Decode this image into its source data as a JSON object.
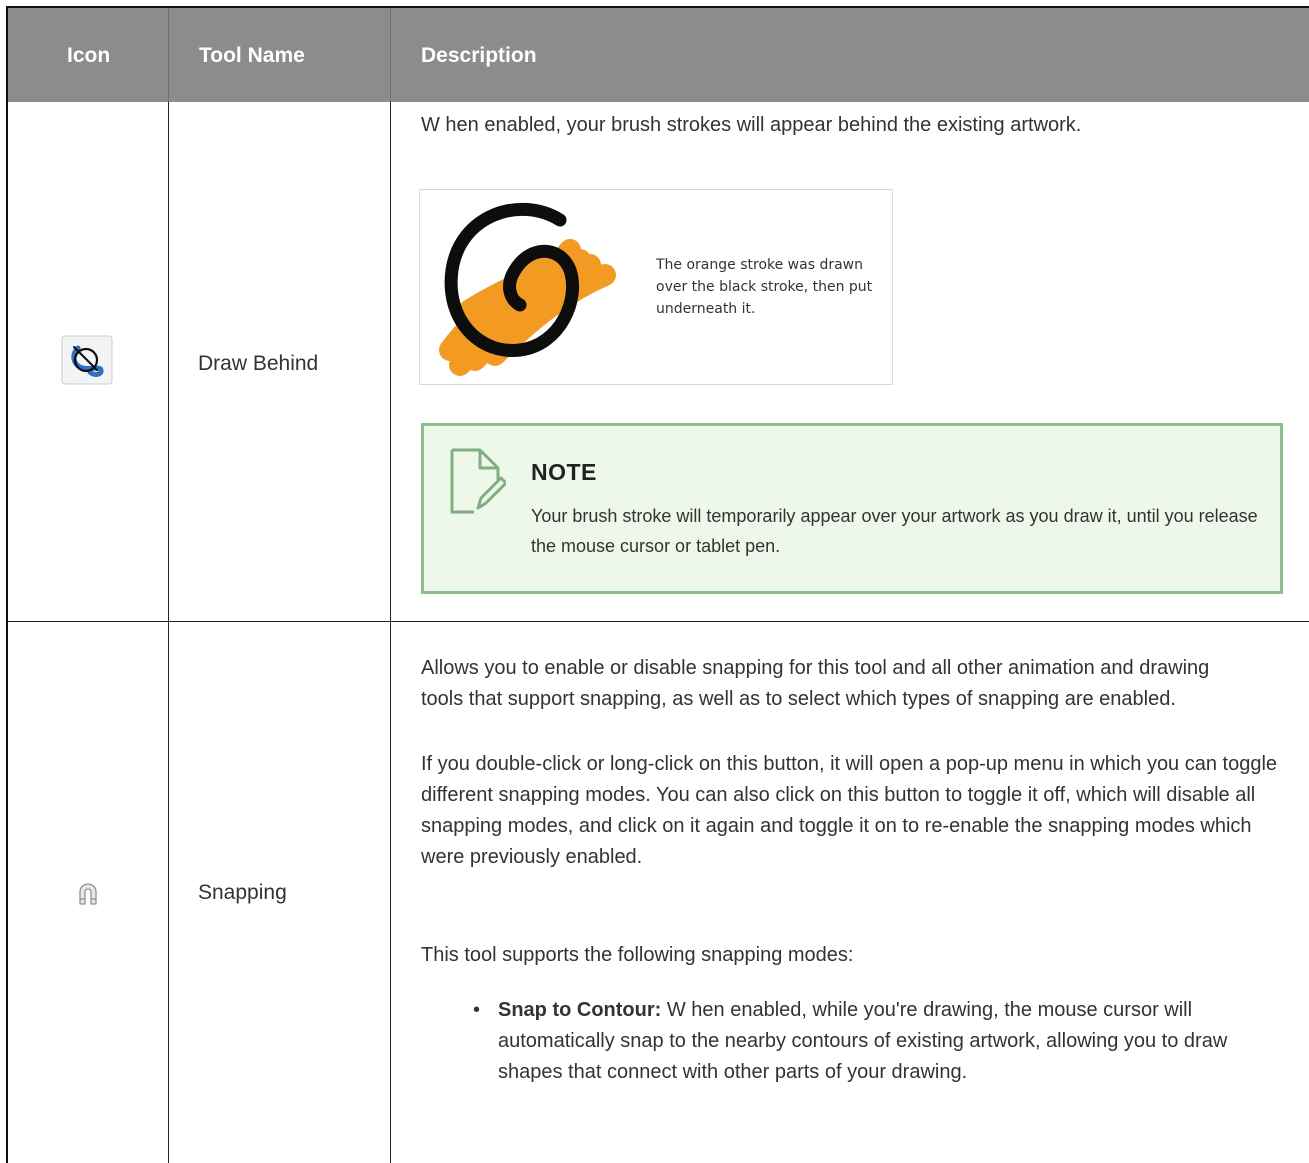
{
  "table": {
    "headers": {
      "icon": "Icon",
      "tool_name": "Tool Name",
      "description": "Description"
    },
    "rows": [
      {
        "icon": "draw-behind-icon",
        "name": "Draw Behind",
        "description": "W hen enabled, your brush strokes will appear behind the existing artwork.",
        "figure_caption": "The orange stroke was drawn over the black stroke, then put underneath it.",
        "note": {
          "title": "NOTE",
          "text": "Your brush stroke will temporarily appear over your artwork as you draw it, until you release the mouse cursor or tablet pen."
        }
      },
      {
        "icon": "magnet-icon",
        "name": "Snapping",
        "paragraphs": [
          "Allows you to enable or disable snapping for this tool and all other animation and drawing tools that support snapping, as well as to select which types of snapping are enabled.",
          "If you double-click or long-click on this button, it will open a pop-up menu in which you can toggle different snapping modes. You can also click on this button to toggle it off, which will disable all snapping modes, and click on it again and toggle it on to re-enable the snapping modes which were previously enabled.",
          "This tool supports the following snapping modes:"
        ],
        "modes": [
          {
            "label": "Snap to Contour:",
            "text": "W hen enabled, while you're drawing, the mouse cursor will automatically snap to the nearby contours of existing artwork, allowing you to draw shapes that connect with other parts of your drawing."
          }
        ]
      }
    ]
  },
  "colors": {
    "header_bg": "#8b8c8e",
    "note_bg": "#eef8ea",
    "note_border": "#8cbf8d",
    "stroke_orange": "#f39a22",
    "stroke_black": "#0d0d0d",
    "draw_behind_blue": "#2f6fc4"
  }
}
